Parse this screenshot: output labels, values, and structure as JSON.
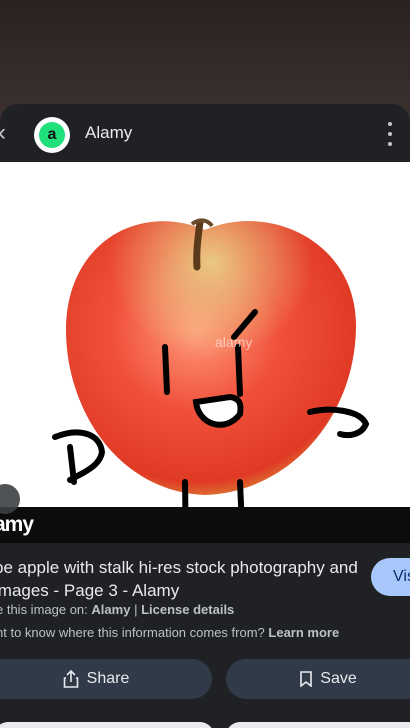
{
  "header": {
    "site_name": "Alamy",
    "logo_letter": "a",
    "logo_color": "#1fe07a"
  },
  "image": {
    "watermark_center": "alamy",
    "watermark_bar_text": "amy"
  },
  "result": {
    "title": "pe apple with stalk hi-res stock photography and images - Page 3 - Alamy",
    "visit_label": "Vis",
    "source_prefix": "e this image on:",
    "source_site": "Alamy",
    "separator": "|",
    "license_label": "License details",
    "info_prefix": "nt to know where this information comes from?",
    "learn_more": "Learn more"
  },
  "actions": {
    "share_label": "Share",
    "save_label": "Save"
  },
  "colors": {
    "sheet_bg": "#202124",
    "button_bg": "#303a48",
    "visit_bg": "#a8c7fa"
  }
}
